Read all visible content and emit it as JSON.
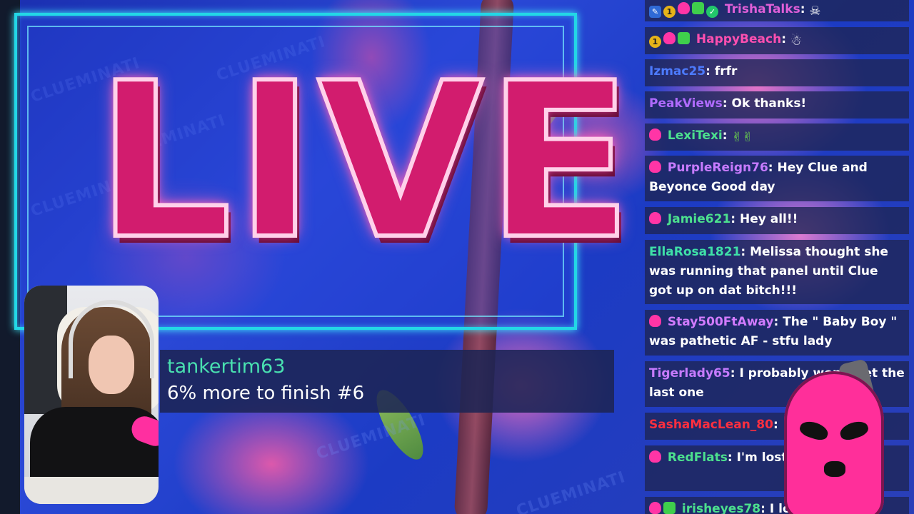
{
  "overlay": {
    "live_label": "LIVE",
    "watermark_text": "CLUEMINATI"
  },
  "alert": {
    "username": "tankertim63",
    "message": "6% more to finish #6"
  },
  "chat": {
    "messages": [
      {
        "user": "TrishaTalks",
        "user_color": "#e05fd8",
        "text": "",
        "badges": [
          "wrench-badge",
          "one-badge",
          "mask-badge",
          "gift-badge",
          "verified-badge"
        ],
        "emote": "skull-emote"
      },
      {
        "user": "HappyBeach",
        "user_color": "#ff4fb0",
        "text": "",
        "badges": [
          "one-badge",
          "mask-badge",
          "gift-badge"
        ],
        "emote": "snowman-emote"
      },
      {
        "user": "Izmac25",
        "user_color": "#4d7bff",
        "text": "frfr",
        "badges": []
      },
      {
        "user": "PeakViews",
        "user_color": "#b06bff",
        "text": "Ok thanks!",
        "badges": []
      },
      {
        "user": "LexiTexi",
        "user_color": "#4ce08e",
        "text": "",
        "badges": [
          "mask-badge"
        ],
        "emote": "dancing-emote"
      },
      {
        "user": "PurpleReign76",
        "user_color": "#c77bff",
        "text": "Hey Clue and Beyonce Good day",
        "badges": [
          "mask-badge"
        ]
      },
      {
        "user": "Jamie621",
        "user_color": "#4ce08e",
        "text": "Hey all!!",
        "badges": [
          "mask-badge"
        ]
      },
      {
        "user": "EllaRosa1821",
        "user_color": "#3fe0a8",
        "text": "Melissa thought she was running that panel until Clue got up on dat bitch!!!",
        "badges": []
      },
      {
        "user": "Stay500FtAway",
        "user_color": "#d27bff",
        "text": "The \" Baby Boy \" was pathetic AF - stfu lady",
        "badges": [
          "mask-badge"
        ]
      },
      {
        "user": "Tigerlady65",
        "user_color": "#c77bff",
        "text": "I probably won't get the last one",
        "badges": []
      },
      {
        "user": "SashaMacLean_80",
        "user_color": "#ff2f3f",
        "text": "",
        "badges": []
      },
      {
        "user": "RedFlats",
        "user_color": "#4ce08e",
        "text": "I'm lost... happened?",
        "badges": [
          "mask-badge"
        ]
      },
      {
        "user": "irisheyes78",
        "user_color": "#4ce08e",
        "text": "I lost",
        "badges": [
          "mask-badge",
          "gift-badge"
        ]
      }
    ]
  },
  "colors": {
    "frame_cyan": "#23d7e6",
    "live_pink": "#d21c6e",
    "chat_bg": "#1e2656",
    "alert_user": "#49e0b0"
  }
}
